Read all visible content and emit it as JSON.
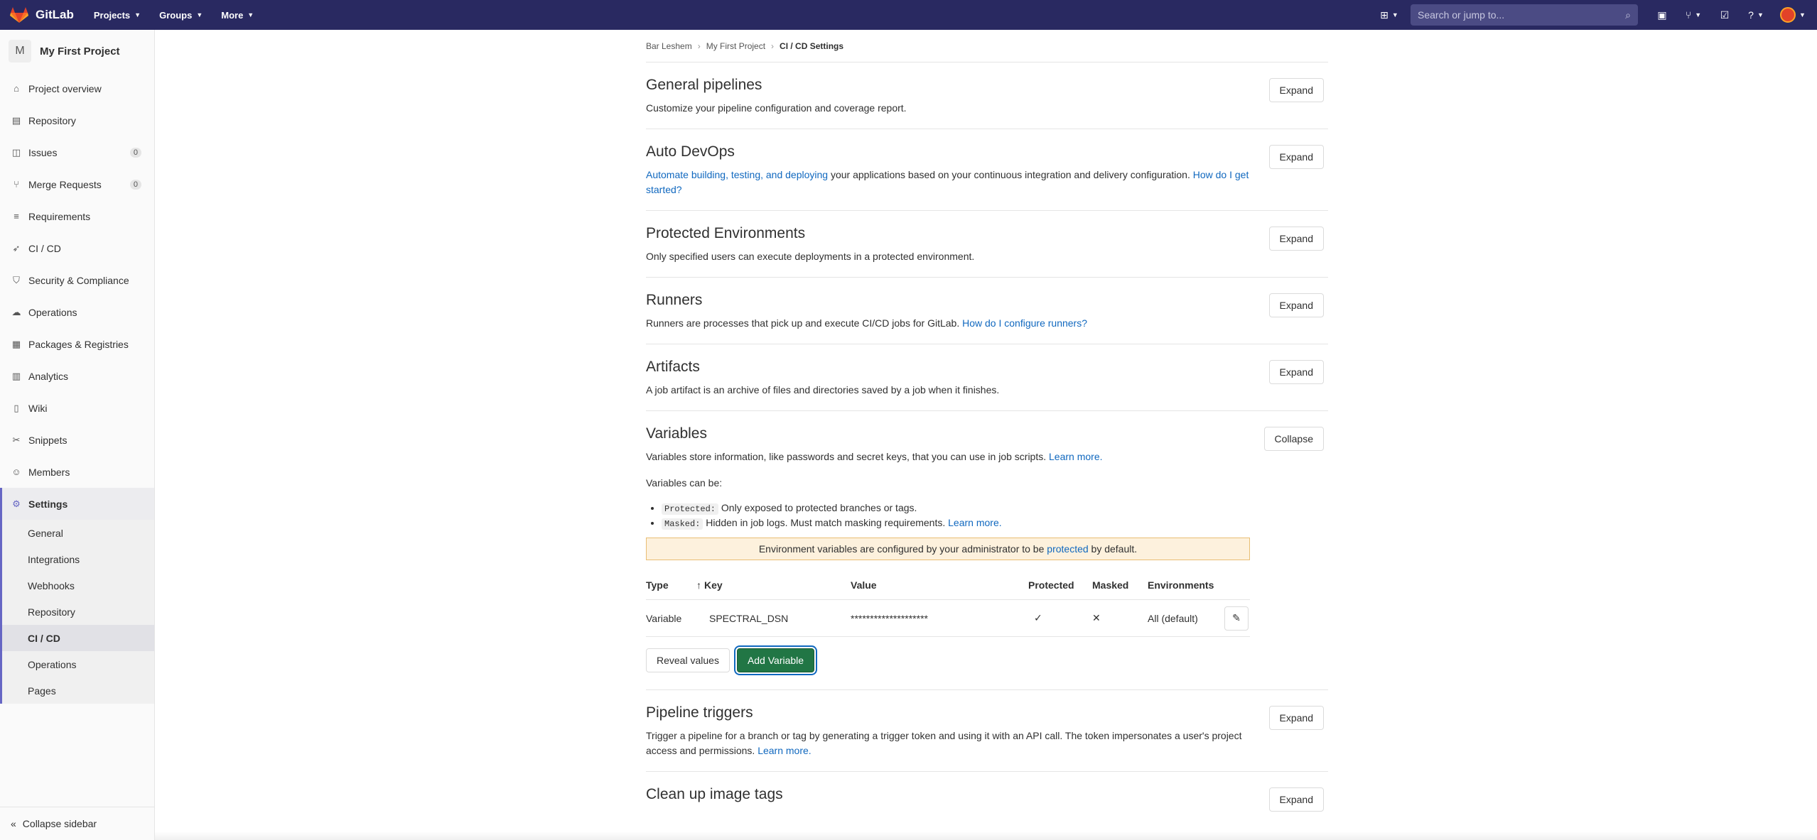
{
  "navbar": {
    "brand": "GitLab",
    "menus": [
      "Projects",
      "Groups",
      "More"
    ],
    "search_placeholder": "Search or jump to..."
  },
  "sidebar": {
    "project_initial": "M",
    "project_name": "My First Project",
    "items": [
      {
        "label": "Project overview",
        "icon": "home-icon"
      },
      {
        "label": "Repository",
        "icon": "doc-icon"
      },
      {
        "label": "Issues",
        "icon": "issues-icon",
        "count": "0"
      },
      {
        "label": "Merge Requests",
        "icon": "merge-icon",
        "count": "0"
      },
      {
        "label": "Requirements",
        "icon": "list-icon"
      },
      {
        "label": "CI / CD",
        "icon": "rocket-icon"
      },
      {
        "label": "Security & Compliance",
        "icon": "shield-icon"
      },
      {
        "label": "Operations",
        "icon": "cloud-icon"
      },
      {
        "label": "Packages & Registries",
        "icon": "package-icon"
      },
      {
        "label": "Analytics",
        "icon": "chart-icon"
      },
      {
        "label": "Wiki",
        "icon": "book-icon"
      },
      {
        "label": "Snippets",
        "icon": "scissors-icon"
      },
      {
        "label": "Members",
        "icon": "users-icon"
      },
      {
        "label": "Settings",
        "icon": "gear-icon"
      }
    ],
    "settings_sub": [
      "General",
      "Integrations",
      "Webhooks",
      "Repository",
      "CI / CD",
      "Operations",
      "Pages"
    ],
    "collapse_label": "Collapse sidebar"
  },
  "breadcrumb": {
    "items": [
      "Bar Leshem",
      "My First Project",
      "CI / CD Settings"
    ]
  },
  "sections": {
    "general": {
      "title": "General pipelines",
      "desc": "Customize your pipeline configuration and coverage report.",
      "button": "Expand"
    },
    "autodevops": {
      "title": "Auto DevOps",
      "link1": "Automate building, testing, and deploying",
      "desc": " your applications based on your continuous integration and delivery configuration. ",
      "link2": "How do I get started?",
      "button": "Expand"
    },
    "protected_env": {
      "title": "Protected Environments",
      "desc": "Only specified users can execute deployments in a protected environment.",
      "button": "Expand"
    },
    "runners": {
      "title": "Runners",
      "desc": "Runners are processes that pick up and execute CI/CD jobs for GitLab. ",
      "link": "How do I configure runners?",
      "button": "Expand"
    },
    "artifacts": {
      "title": "Artifacts",
      "desc": "A job artifact is an archive of files and directories saved by a job when it finishes.",
      "button": "Expand"
    },
    "variables": {
      "title": "Variables",
      "button": "Collapse",
      "desc": "Variables store information, like passwords and secret keys, that you can use in job scripts. ",
      "learn_more": "Learn more.",
      "can_be": "Variables can be:",
      "protected_code": "Protected:",
      "protected_text": " Only exposed to protected branches or tags.",
      "masked_code": "Masked:",
      "masked_text": " Hidden in job logs. Must match masking requirements. ",
      "alert_pre": "Environment variables are configured by your administrator to be ",
      "alert_link": "protected",
      "alert_post": " by default.",
      "columns": {
        "type": "Type",
        "key": "Key",
        "value": "Value",
        "protected": "Protected",
        "masked": "Masked",
        "environments": "Environments"
      },
      "row": {
        "type": "Variable",
        "key": "SPECTRAL_DSN",
        "value": "********************",
        "protected": "✓",
        "masked": "✕",
        "environments": "All (default)"
      },
      "reveal_button": "Reveal values",
      "add_button": "Add Variable"
    },
    "triggers": {
      "title": "Pipeline triggers",
      "desc": "Trigger a pipeline for a branch or tag by generating a trigger token and using it with an API call. The token impersonates a user's project access and permissions. ",
      "link": "Learn more.",
      "button": "Expand"
    },
    "cleanup": {
      "title": "Clean up image tags",
      "button": "Expand"
    }
  }
}
